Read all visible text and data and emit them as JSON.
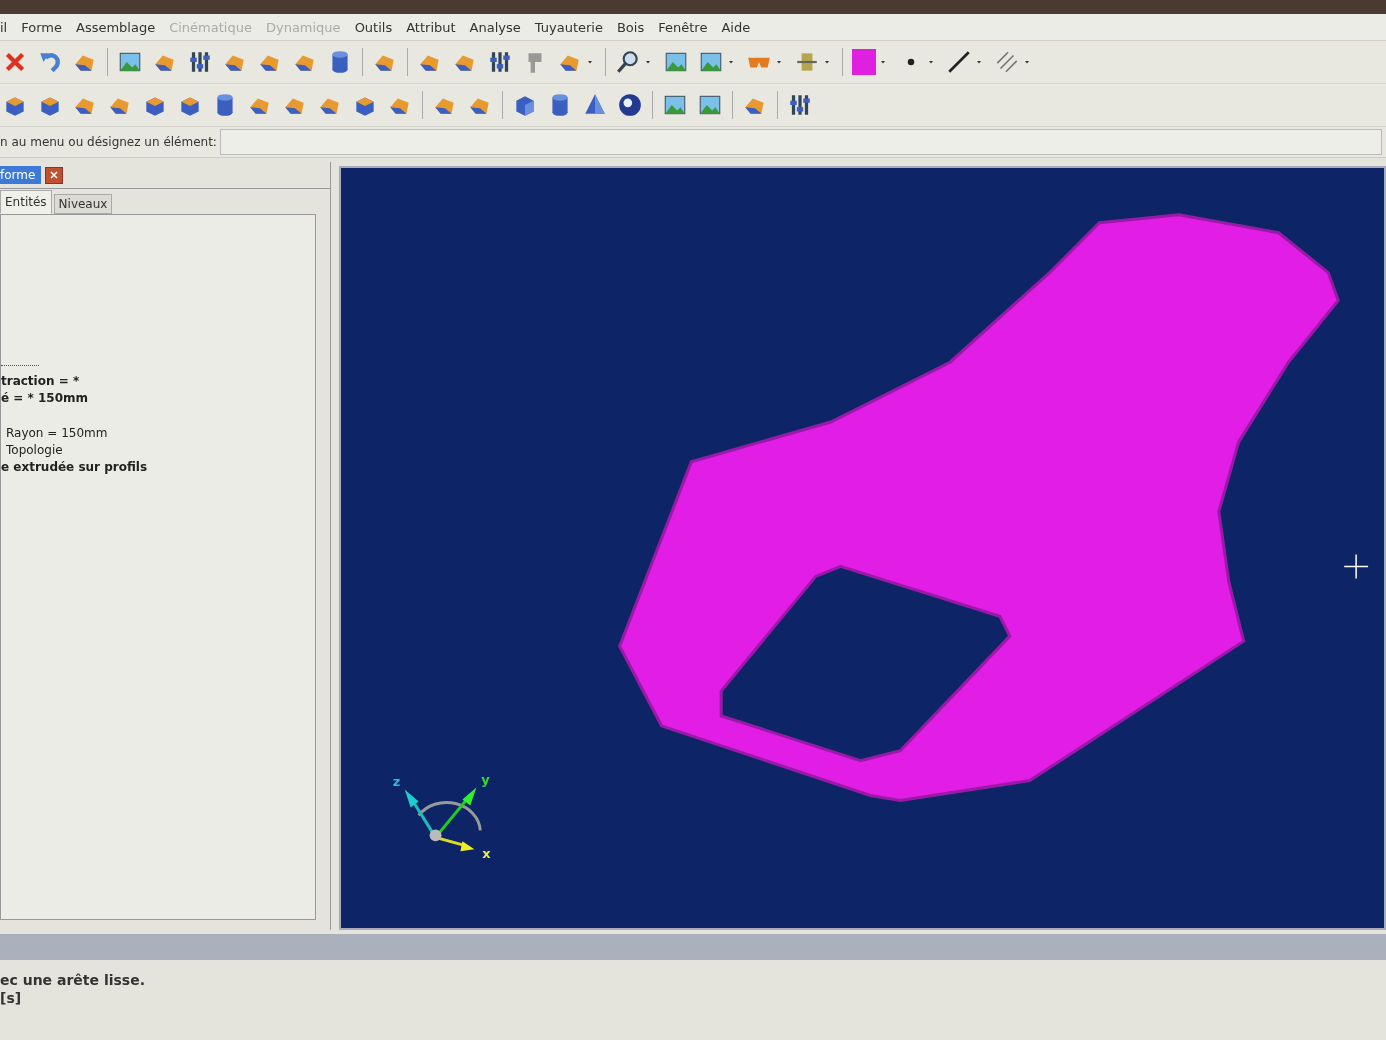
{
  "menu_bar": [
    {
      "label": "il",
      "disabled": false
    },
    {
      "label": "Forme",
      "disabled": false
    },
    {
      "label": "Assemblage",
      "disabled": false
    },
    {
      "label": "Cinématique",
      "disabled": true
    },
    {
      "label": "Dynamique",
      "disabled": true
    },
    {
      "label": "Outils",
      "disabled": false
    },
    {
      "label": "Attribut",
      "disabled": false
    },
    {
      "label": "Analyse",
      "disabled": false
    },
    {
      "label": "Tuyauterie",
      "disabled": false
    },
    {
      "label": "Bois",
      "disabled": false
    },
    {
      "label": "Fenêtre",
      "disabled": false
    },
    {
      "label": "Aide",
      "disabled": false
    }
  ],
  "command_line": {
    "prompt": "n au menu ou désignez un élément:"
  },
  "panel": {
    "title": "forme",
    "tabs": [
      {
        "label": "Entités",
        "selected": true
      },
      {
        "label": "Niveaux",
        "selected": false
      }
    ],
    "tree": [
      {
        "kind": "feature",
        "text": "traction = *"
      },
      {
        "kind": "feature",
        "text": "é = * 150mm"
      },
      {
        "kind": "parameter",
        "text": "Rayon = 150mm"
      },
      {
        "kind": "parameter",
        "text": "Topologie"
      },
      {
        "kind": "feature",
        "text": "e extrudée sur profils"
      }
    ]
  },
  "viewport": {
    "axes": {
      "z": "z",
      "y": "y",
      "x": "x"
    }
  },
  "console": [
    "ec une arête lisse.",
    "[s]"
  ]
}
